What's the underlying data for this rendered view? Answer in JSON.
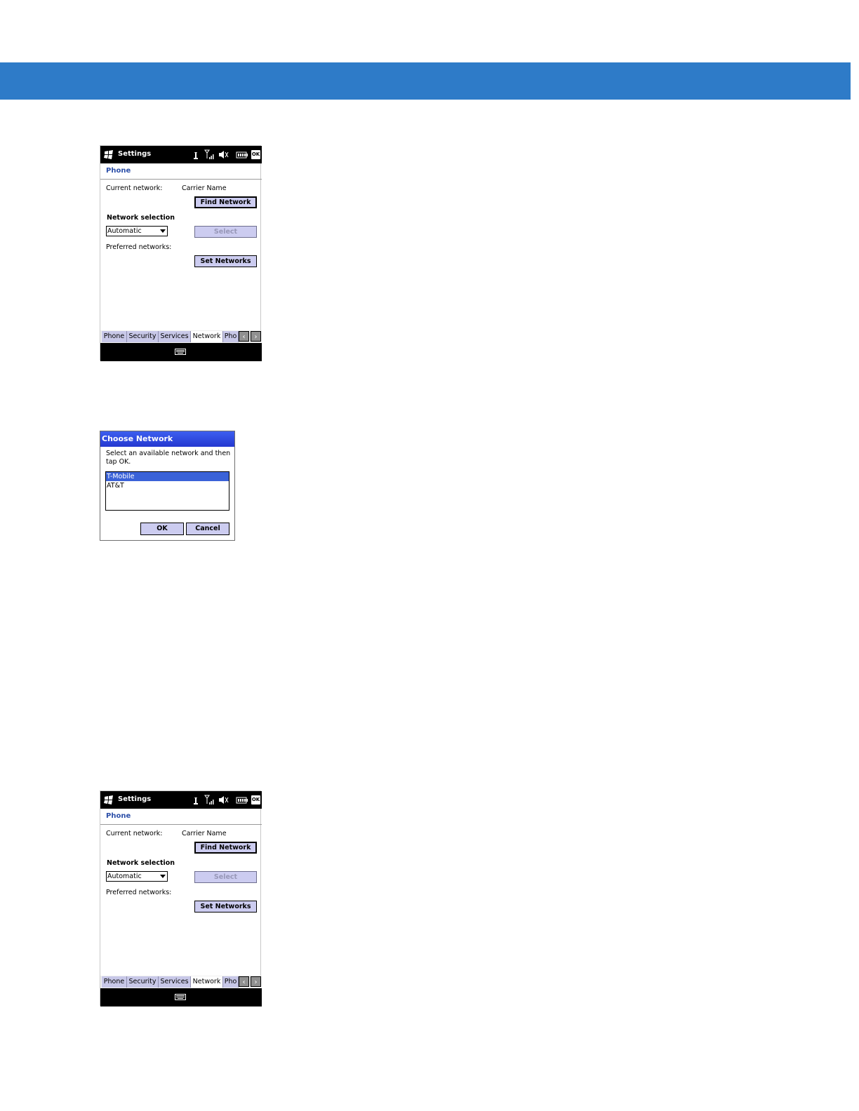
{
  "screens": [
    {
      "statusbar": {
        "title": "Settings",
        "ok": "OK"
      },
      "header": "Phone",
      "current_network_label": "Current network:",
      "carrier_name": "Carrier Name",
      "find_network": "Find Network",
      "network_selection_label": "Network selection",
      "selection_value": "Automatic",
      "select": "Select",
      "preferred_networks_label": "Preferred networks:",
      "set_networks": "Set Networks",
      "tabs": [
        "Phone",
        "Security",
        "Services",
        "Network",
        "Pho"
      ],
      "active_tab": "Network"
    },
    {
      "statusbar": {
        "title": "Settings",
        "ok": "OK"
      },
      "header": "Phone",
      "current_network_label": "Current network:",
      "carrier_name": "Carrier Name",
      "find_network": "Find Network",
      "network_selection_label": "Network selection",
      "selection_value": "Automatic",
      "select": "Select",
      "preferred_networks_label": "Preferred networks:",
      "set_networks": "Set Networks",
      "tabs": [
        "Phone",
        "Security",
        "Services",
        "Network",
        "Pho"
      ],
      "active_tab": "Network"
    }
  ],
  "dialog": {
    "title": "Choose Network",
    "instruction": "Select an available network and then tap OK.",
    "networks": [
      "T-Mobile",
      "AT&T"
    ],
    "selected": "T-Mobile",
    "ok": "OK",
    "cancel": "Cancel"
  },
  "colors": {
    "banner": "#2e7bc8",
    "button_face": "#ccccf0",
    "dialog_title": "#2e48e0",
    "header_text": "#2c4fa8"
  }
}
